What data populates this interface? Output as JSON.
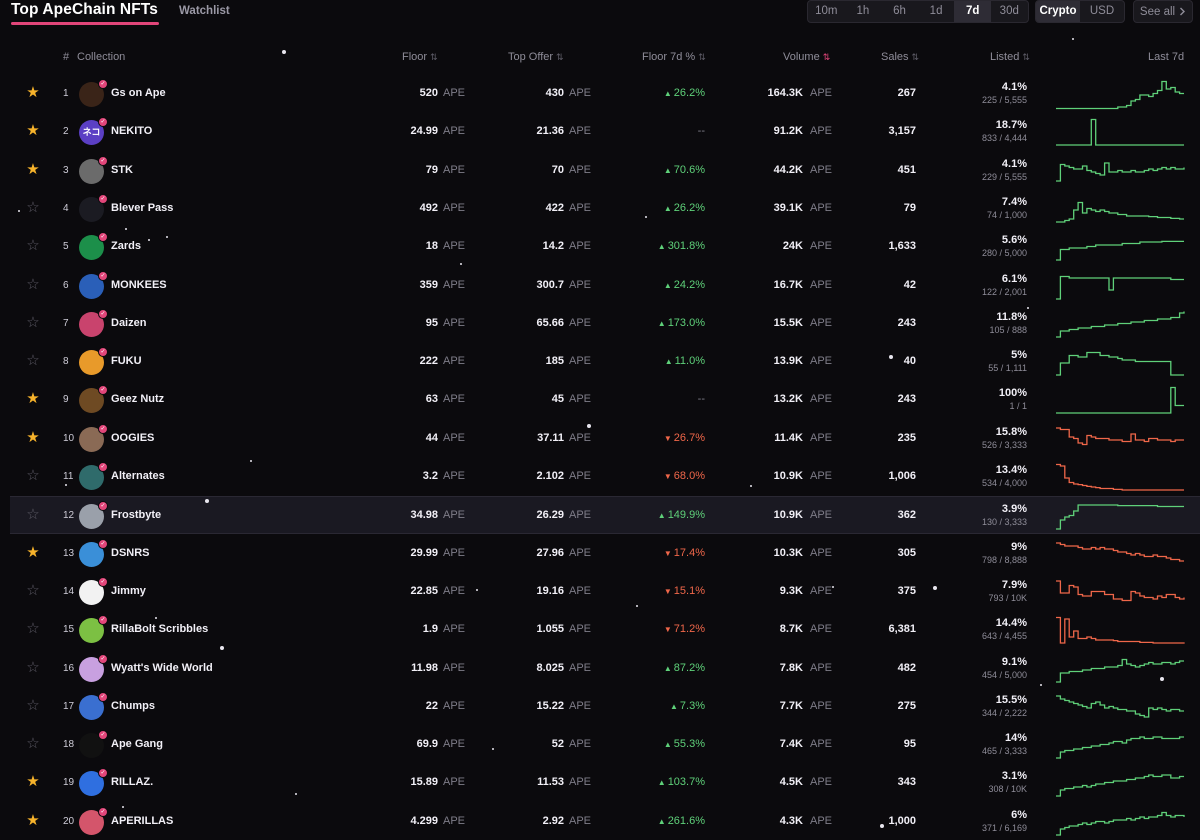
{
  "header": {
    "title": "Top ApeChain NFTs",
    "watchlist_tab": "Watchlist",
    "time_options": [
      "10m",
      "1h",
      "6h",
      "1d",
      "7d",
      "30d"
    ],
    "active_time": "7d",
    "currency_options": [
      "Crypto",
      "USD"
    ],
    "active_currency": "Crypto",
    "see_all": "See all",
    "see_all_icon": "chevron-right-icon"
  },
  "columns": {
    "rank": "#",
    "collection": "Collection",
    "floor": "Floor",
    "top_offer": "Top Offer",
    "floor_change": "Floor 7d %",
    "volume": "Volume",
    "sales": "Sales",
    "listed": "Listed",
    "last": "Last 7d"
  },
  "colors": {
    "accent": "#e2467a",
    "up": "#5fd17a",
    "down": "#f0674a",
    "star": "#f7b32b"
  },
  "rows": [
    {
      "rank": "1",
      "name": "Gs on Ape",
      "floor": "520",
      "floor_unit": "APE",
      "offer": "430",
      "offer_unit": "APE",
      "change": "26.2%",
      "dir": "up",
      "volume": "164.3K",
      "volume_unit": "APE",
      "sales": "267",
      "listed_pct": "4.1%",
      "listed": "225 / 5,555",
      "starred": true,
      "avatar_color": "#3a2418",
      "spark": [
        0.05,
        0.05,
        0.05,
        0.05,
        0.05,
        0.05,
        0.05,
        0.05,
        0.05,
        0.05,
        0.05,
        0.05,
        0.05,
        0.05,
        0.1,
        0.1,
        0.15,
        0.3,
        0.35,
        0.5,
        0.5,
        0.45,
        0.55,
        0.65,
        0.95,
        0.7,
        0.75,
        0.6,
        0.55,
        0.55
      ]
    },
    {
      "rank": "2",
      "name": "NEKITO",
      "floor": "24.99",
      "floor_unit": "APE",
      "offer": "21.36",
      "offer_unit": "APE",
      "change": "--",
      "dir": "flat",
      "volume": "91.2K",
      "volume_unit": "APE",
      "sales": "3,157",
      "listed_pct": "18.7%",
      "listed": "833 / 4,444",
      "starred": true,
      "avatar_color": "#5b3fc4",
      "avatar_text": "ネコ",
      "spark": [
        0.1,
        0.1,
        0.1,
        0.1,
        0.1,
        0.1,
        0.1,
        0.1,
        0.95,
        0.1,
        0.1,
        0.1,
        0.1,
        0.1,
        0.1,
        0.1,
        0.1,
        0.1,
        0.1,
        0.1,
        0.1,
        0.1,
        0.1,
        0.1,
        0.1,
        0.1,
        0.1,
        0.1,
        0.1,
        0.1
      ]
    },
    {
      "rank": "3",
      "name": "STK",
      "floor": "79",
      "floor_unit": "APE",
      "offer": "70",
      "offer_unit": "APE",
      "change": "70.6%",
      "dir": "up",
      "volume": "44.2K",
      "volume_unit": "APE",
      "sales": "451",
      "listed_pct": "4.1%",
      "listed": "229 / 5,555",
      "starred": true,
      "avatar_color": "#6b6b6b",
      "spark": [
        0.2,
        0.75,
        0.7,
        0.65,
        0.6,
        0.6,
        0.7,
        0.55,
        0.5,
        0.45,
        0.4,
        0.8,
        0.5,
        0.5,
        0.55,
        0.5,
        0.5,
        0.55,
        0.5,
        0.5,
        0.55,
        0.6,
        0.55,
        0.6,
        0.65,
        0.6,
        0.65,
        0.6,
        0.6,
        0.65
      ]
    },
    {
      "rank": "4",
      "name": "Blever Pass",
      "floor": "492",
      "floor_unit": "APE",
      "offer": "422",
      "offer_unit": "APE",
      "change": "26.2%",
      "dir": "up",
      "volume": "39.1K",
      "volume_unit": "APE",
      "sales": "79",
      "listed_pct": "7.4%",
      "listed": "74 / 1,000",
      "starred": false,
      "avatar_color": "#1b1b22",
      "spark": [
        0.1,
        0.1,
        0.15,
        0.2,
        0.5,
        0.75,
        0.4,
        0.55,
        0.5,
        0.45,
        0.5,
        0.45,
        0.4,
        0.4,
        0.35,
        0.35,
        0.3,
        0.3,
        0.3,
        0.3,
        0.3,
        0.28,
        0.28,
        0.25,
        0.25,
        0.25,
        0.22,
        0.22,
        0.2,
        0.2
      ]
    },
    {
      "rank": "5",
      "name": "Zards",
      "floor": "18",
      "floor_unit": "APE",
      "offer": "14.2",
      "offer_unit": "APE",
      "change": "301.8%",
      "dir": "up",
      "volume": "24K",
      "volume_unit": "APE",
      "sales": "1,633",
      "listed_pct": "5.6%",
      "listed": "280 / 5,000",
      "starred": false,
      "avatar_color": "#1c8f4a",
      "spark": [
        0.1,
        0.45,
        0.45,
        0.5,
        0.5,
        0.5,
        0.5,
        0.55,
        0.55,
        0.6,
        0.6,
        0.6,
        0.6,
        0.6,
        0.6,
        0.65,
        0.65,
        0.65,
        0.65,
        0.7,
        0.7,
        0.7,
        0.7,
        0.7,
        0.72,
        0.72,
        0.72,
        0.72,
        0.72,
        0.72
      ]
    },
    {
      "rank": "6",
      "name": "MONKEES",
      "floor": "359",
      "floor_unit": "APE",
      "offer": "300.7",
      "offer_unit": "APE",
      "change": "24.2%",
      "dir": "up",
      "volume": "16.7K",
      "volume_unit": "APE",
      "sales": "42",
      "listed_pct": "6.1%",
      "listed": "122 / 2,001",
      "starred": false,
      "avatar_color": "#2a5fb8",
      "spark": [
        0.1,
        0.85,
        0.85,
        0.8,
        0.8,
        0.8,
        0.8,
        0.8,
        0.8,
        0.8,
        0.8,
        0.8,
        0.4,
        0.8,
        0.8,
        0.8,
        0.8,
        0.8,
        0.8,
        0.8,
        0.8,
        0.8,
        0.8,
        0.8,
        0.8,
        0.8,
        0.75,
        0.75,
        0.75,
        0.75
      ]
    },
    {
      "rank": "7",
      "name": "Daizen",
      "floor": "95",
      "floor_unit": "APE",
      "offer": "65.66",
      "offer_unit": "APE",
      "change": "173.0%",
      "dir": "up",
      "volume": "15.5K",
      "volume_unit": "APE",
      "sales": "243",
      "listed_pct": "11.8%",
      "listed": "105 / 888",
      "starred": false,
      "avatar_color": "#c9436d",
      "spark": [
        0.1,
        0.3,
        0.3,
        0.35,
        0.35,
        0.4,
        0.4,
        0.4,
        0.45,
        0.45,
        0.45,
        0.5,
        0.5,
        0.5,
        0.55,
        0.55,
        0.55,
        0.6,
        0.6,
        0.6,
        0.65,
        0.65,
        0.65,
        0.7,
        0.7,
        0.7,
        0.75,
        0.75,
        0.9,
        0.95
      ]
    },
    {
      "rank": "8",
      "name": "FUKU",
      "floor": "222",
      "floor_unit": "APE",
      "offer": "185",
      "offer_unit": "APE",
      "change": "11.0%",
      "dir": "up",
      "volume": "13.9K",
      "volume_unit": "APE",
      "sales": "40",
      "listed_pct": "5%",
      "listed": "55 / 1,111",
      "starred": false,
      "avatar_color": "#e89a2a",
      "spark": [
        0.1,
        0.5,
        0.5,
        0.75,
        0.75,
        0.7,
        0.7,
        0.85,
        0.85,
        0.85,
        0.75,
        0.75,
        0.7,
        0.7,
        0.65,
        0.6,
        0.6,
        0.6,
        0.55,
        0.55,
        0.55,
        0.55,
        0.55,
        0.55,
        0.55,
        0.55,
        0.1,
        0.1,
        0.1,
        0.1
      ]
    },
    {
      "rank": "9",
      "name": "Geez Nutz",
      "floor": "63",
      "floor_unit": "APE",
      "offer": "45",
      "offer_unit": "APE",
      "change": "--",
      "dir": "flat",
      "volume": "13.2K",
      "volume_unit": "APE",
      "sales": "243",
      "listed_pct": "100%",
      "listed": "1 / 1",
      "starred": true,
      "avatar_color": "#6e4a23",
      "spark": [
        0.1,
        0.1,
        0.1,
        0.1,
        0.1,
        0.1,
        0.1,
        0.1,
        0.1,
        0.1,
        0.1,
        0.1,
        0.1,
        0.1,
        0.1,
        0.1,
        0.1,
        0.1,
        0.1,
        0.1,
        0.1,
        0.1,
        0.1,
        0.1,
        0.1,
        0.1,
        0.95,
        0.35,
        0.35,
        0.35
      ]
    },
    {
      "rank": "10",
      "name": "OOGIES",
      "floor": "44",
      "floor_unit": "APE",
      "offer": "37.11",
      "offer_unit": "APE",
      "change": "26.7%",
      "dir": "down",
      "volume": "11.4K",
      "volume_unit": "APE",
      "sales": "235",
      "listed_pct": "15.8%",
      "listed": "526 / 3,333",
      "starred": true,
      "avatar_color": "#8a6a55",
      "spark": [
        0.9,
        0.85,
        0.85,
        0.6,
        0.55,
        0.4,
        0.35,
        0.65,
        0.6,
        0.55,
        0.55,
        0.55,
        0.5,
        0.5,
        0.5,
        0.45,
        0.45,
        0.7,
        0.5,
        0.5,
        0.45,
        0.55,
        0.55,
        0.5,
        0.5,
        0.5,
        0.45,
        0.5,
        0.5,
        0.5
      ]
    },
    {
      "rank": "11",
      "name": "Alternates",
      "floor": "3.2",
      "floor_unit": "APE",
      "offer": "2.102",
      "offer_unit": "APE",
      "change": "68.0%",
      "dir": "down",
      "volume": "10.9K",
      "volume_unit": "APE",
      "sales": "1,006",
      "listed_pct": "13.4%",
      "listed": "534 / 4,000",
      "starred": false,
      "avatar_color": "#2f6b6b",
      "spark": [
        0.95,
        0.9,
        0.5,
        0.35,
        0.3,
        0.28,
        0.25,
        0.22,
        0.2,
        0.18,
        0.15,
        0.15,
        0.15,
        0.12,
        0.12,
        0.1,
        0.1,
        0.1,
        0.1,
        0.1,
        0.1,
        0.1,
        0.1,
        0.1,
        0.1,
        0.1,
        0.1,
        0.1,
        0.1,
        0.1
      ]
    },
    {
      "rank": "12",
      "name": "Frostbyte",
      "floor": "34.98",
      "floor_unit": "APE",
      "offer": "26.29",
      "offer_unit": "APE",
      "change": "149.9%",
      "dir": "up",
      "volume": "10.9K",
      "volume_unit": "APE",
      "sales": "362",
      "listed_pct": "3.9%",
      "listed": "130 / 3,333",
      "starred": false,
      "highlight": true,
      "avatar_color": "#9aa0aa",
      "spark": [
        0.1,
        0.4,
        0.5,
        0.55,
        0.7,
        0.9,
        0.9,
        0.9,
        0.9,
        0.9,
        0.9,
        0.9,
        0.9,
        0.9,
        0.88,
        0.88,
        0.88,
        0.88,
        0.88,
        0.88,
        0.88,
        0.88,
        0.88,
        0.85,
        0.85,
        0.85,
        0.85,
        0.85,
        0.85,
        0.85
      ]
    },
    {
      "rank": "13",
      "name": "DSNRS",
      "floor": "29.99",
      "floor_unit": "APE",
      "offer": "27.96",
      "offer_unit": "APE",
      "change": "17.4%",
      "dir": "down",
      "volume": "10.3K",
      "volume_unit": "APE",
      "sales": "305",
      "listed_pct": "9%",
      "listed": "798 / 8,888",
      "starred": true,
      "avatar_color": "#3a8fd8",
      "spark": [
        0.9,
        0.85,
        0.8,
        0.8,
        0.8,
        0.75,
        0.7,
        0.7,
        0.75,
        0.7,
        0.75,
        0.7,
        0.7,
        0.65,
        0.6,
        0.6,
        0.55,
        0.5,
        0.55,
        0.5,
        0.45,
        0.45,
        0.5,
        0.45,
        0.45,
        0.4,
        0.35,
        0.35,
        0.3,
        0.3
      ]
    },
    {
      "rank": "14",
      "name": "Jimmy",
      "floor": "22.85",
      "floor_unit": "APE",
      "offer": "19.16",
      "offer_unit": "APE",
      "change": "15.1%",
      "dir": "down",
      "volume": "9.3K",
      "volume_unit": "APE",
      "sales": "375",
      "listed_pct": "7.9%",
      "listed": "793 / 10K",
      "starred": false,
      "avatar_color": "#f2f2f2",
      "spark": [
        0.9,
        0.5,
        0.5,
        0.75,
        0.7,
        0.45,
        0.4,
        0.4,
        0.55,
        0.55,
        0.55,
        0.45,
        0.45,
        0.3,
        0.3,
        0.25,
        0.25,
        0.55,
        0.5,
        0.4,
        0.35,
        0.35,
        0.3,
        0.4,
        0.35,
        0.45,
        0.45,
        0.35,
        0.3,
        0.35
      ]
    },
    {
      "rank": "15",
      "name": "RillaBolt Scribbles",
      "floor": "1.9",
      "floor_unit": "APE",
      "offer": "1.055",
      "offer_unit": "APE",
      "change": "71.2%",
      "dir": "down",
      "volume": "8.7K",
      "volume_unit": "APE",
      "sales": "6,381",
      "listed_pct": "14.4%",
      "listed": "643 / 4,455",
      "starred": false,
      "avatar_color": "#7cc043",
      "spark": [
        0.95,
        0.1,
        0.9,
        0.3,
        0.5,
        0.25,
        0.25,
        0.3,
        0.25,
        0.2,
        0.2,
        0.2,
        0.2,
        0.18,
        0.15,
        0.15,
        0.15,
        0.15,
        0.15,
        0.12,
        0.12,
        0.12,
        0.1,
        0.1,
        0.1,
        0.1,
        0.1,
        0.1,
        0.1,
        0.08
      ]
    },
    {
      "rank": "16",
      "name": "Wyatt's Wide World",
      "floor": "11.98",
      "floor_unit": "APE",
      "offer": "8.025",
      "offer_unit": "APE",
      "change": "87.2%",
      "dir": "up",
      "volume": "7.8K",
      "volume_unit": "APE",
      "sales": "482",
      "listed_pct": "9.1%",
      "listed": "454 / 5,000",
      "starred": false,
      "avatar_color": "#c8a0e0",
      "spark": [
        0.1,
        0.4,
        0.4,
        0.45,
        0.45,
        0.45,
        0.5,
        0.5,
        0.55,
        0.55,
        0.55,
        0.6,
        0.6,
        0.6,
        0.65,
        0.85,
        0.7,
        0.65,
        0.6,
        0.65,
        0.7,
        0.75,
        0.7,
        0.7,
        0.75,
        0.75,
        0.7,
        0.75,
        0.8,
        0.8
      ]
    },
    {
      "rank": "17",
      "name": "Chumps",
      "floor": "22",
      "floor_unit": "APE",
      "offer": "15.22",
      "offer_unit": "APE",
      "change": "7.3%",
      "dir": "up",
      "volume": "7.7K",
      "volume_unit": "APE",
      "sales": "275",
      "listed_pct": "15.5%",
      "listed": "344 / 2,222",
      "starred": false,
      "avatar_color": "#3a6fd0",
      "spark": [
        0.9,
        0.8,
        0.75,
        0.7,
        0.65,
        0.6,
        0.55,
        0.5,
        0.65,
        0.7,
        0.6,
        0.5,
        0.55,
        0.5,
        0.45,
        0.45,
        0.4,
        0.4,
        0.3,
        0.25,
        0.2,
        0.5,
        0.45,
        0.5,
        0.45,
        0.4,
        0.45,
        0.45,
        0.4,
        0.4
      ]
    },
    {
      "rank": "18",
      "name": "Ape Gang",
      "floor": "69.9",
      "floor_unit": "APE",
      "offer": "52",
      "offer_unit": "APE",
      "change": "55.3%",
      "dir": "up",
      "volume": "7.4K",
      "volume_unit": "APE",
      "sales": "95",
      "listed_pct": "14%",
      "listed": "465 / 3,333",
      "starred": false,
      "avatar_color": "#111111",
      "spark": [
        0.1,
        0.3,
        0.35,
        0.35,
        0.4,
        0.4,
        0.45,
        0.45,
        0.5,
        0.5,
        0.55,
        0.55,
        0.6,
        0.65,
        0.65,
        0.6,
        0.7,
        0.75,
        0.75,
        0.8,
        0.75,
        0.75,
        0.8,
        0.8,
        0.75,
        0.75,
        0.75,
        0.75,
        0.8,
        0.8
      ]
    },
    {
      "rank": "19",
      "name": "RILLAZ.",
      "floor": "15.89",
      "floor_unit": "APE",
      "offer": "11.53",
      "offer_unit": "APE",
      "change": "103.7%",
      "dir": "up",
      "volume": "4.5K",
      "volume_unit": "APE",
      "sales": "343",
      "listed_pct": "3.1%",
      "listed": "308 / 10K",
      "starred": true,
      "avatar_color": "#2f6fe0",
      "spark": [
        0.1,
        0.3,
        0.35,
        0.35,
        0.4,
        0.4,
        0.45,
        0.4,
        0.45,
        0.5,
        0.5,
        0.55,
        0.55,
        0.6,
        0.6,
        0.6,
        0.65,
        0.65,
        0.7,
        0.7,
        0.75,
        0.8,
        0.75,
        0.75,
        0.8,
        0.8,
        0.7,
        0.7,
        0.75,
        0.75
      ]
    },
    {
      "rank": "20",
      "name": "APERILLAS",
      "floor": "4.299",
      "floor_unit": "APE",
      "offer": "2.92",
      "offer_unit": "APE",
      "change": "261.6%",
      "dir": "up",
      "volume": "4.3K",
      "volume_unit": "APE",
      "sales": "1,000",
      "listed_pct": "6%",
      "listed": "371 / 6,169",
      "starred": true,
      "avatar_color": "#d4556b",
      "spark": [
        0.1,
        0.3,
        0.35,
        0.4,
        0.4,
        0.45,
        0.5,
        0.45,
        0.5,
        0.55,
        0.55,
        0.5,
        0.55,
        0.6,
        0.6,
        0.6,
        0.65,
        0.6,
        0.65,
        0.7,
        0.65,
        0.7,
        0.7,
        0.75,
        0.85,
        0.75,
        0.7,
        0.75,
        0.75,
        0.7
      ]
    }
  ]
}
